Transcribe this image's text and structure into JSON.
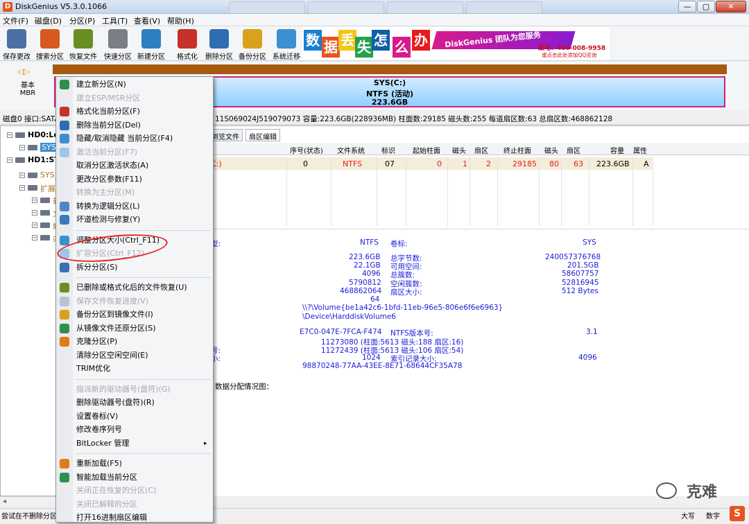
{
  "window": {
    "title": "DiskGenius V5.3.0.1066",
    "minimize_glyph": "—",
    "maximize_glyph": "▢",
    "close_glyph": "✕"
  },
  "menubar": [
    "文件(F)",
    "磁盘(D)",
    "分区(P)",
    "工具(T)",
    "查看(V)",
    "帮助(H)"
  ],
  "toolbar": [
    {
      "label": "保存更改",
      "icon": "save-icon",
      "color": "#4a6fa5"
    },
    {
      "label": "搜索分区",
      "icon": "search-icon",
      "color": "#d9581d"
    },
    {
      "label": "恢复文件",
      "icon": "recover-icon",
      "color": "#6b8e23"
    },
    {
      "label": "快速分区",
      "icon": "quick-partition-icon",
      "color": "#7a7f86"
    },
    {
      "label": "新建分区",
      "icon": "new-partition-icon",
      "color": "#2e7fbf"
    },
    {
      "label": "格式化",
      "icon": "format-icon",
      "color": "#c8302a"
    },
    {
      "label": "删除分区",
      "icon": "delete-icon",
      "color": "#2f6db3"
    },
    {
      "label": "备份分区",
      "icon": "backup-icon",
      "color": "#d8a21c"
    },
    {
      "label": "系统迁移",
      "icon": "migrate-icon",
      "color": "#3c8fd1"
    }
  ],
  "banner": {
    "chars": [
      "数",
      "据",
      "丢",
      "失",
      "怎",
      "么",
      "办"
    ],
    "slogan": "DiskGenius 团队为您服务",
    "phone": "致电：400-008-9958",
    "qq": "或点击此处添加QQ咨询"
  },
  "disk": {
    "type": "基本",
    "scheme": "MBR",
    "partition_name": "SYS(C:)",
    "partition_fs": "NTFS (活动)",
    "partition_size": "223.6GB",
    "info_prefix": "磁盘0 接口:SATA",
    "info_line": "11S069024J519079073  容量:223.6GB(228936MB)  柱面数:29185  磁头数:255  每道扇区数:63  总扇区数:468862128"
  },
  "tree": [
    {
      "text": "HD0:Le",
      "indent": 22,
      "bold": true
    },
    {
      "text": "SYS(",
      "indent": 40,
      "selected": true
    },
    {
      "text": "HD1:ST",
      "indent": 22,
      "bold": true
    },
    {
      "text": "SYS_",
      "indent": 40
    },
    {
      "text": "扩展",
      "indent": 40
    },
    {
      "text": "软",
      "indent": 58
    },
    {
      "text": "文",
      "indent": 58
    },
    {
      "text": "娱",
      "indent": 58
    },
    {
      "text": "办",
      "indent": 58
    }
  ],
  "tabs": [
    "浏览文件",
    "扇区编辑"
  ],
  "table": {
    "headers": [
      "序号(状态)",
      "文件系统",
      "标识",
      "起始柱面",
      "磁头",
      "扇区",
      "终止柱面",
      "磁头",
      "扇区",
      "容量",
      "属性"
    ],
    "row": {
      "name_tail": "C:)",
      "cells": [
        "0",
        "NTFS",
        "07",
        "0",
        "1",
        "2",
        "29185",
        "80",
        "63",
        "223.6GB",
        "A"
      ],
      "accent": "#e81a1a"
    }
  },
  "info": {
    "fs_label_tail": "型:",
    "fs": "NTFS",
    "vol_label": "卷标:",
    "vol": "SYS",
    "total_size": "223.6GB",
    "total_bytes_label": "总字节数:",
    "total_bytes": "240057376768",
    "used": "22.1GB",
    "free_label": "可用空间:",
    "free": "201.5GB",
    "cluster": "4096",
    "total_clusters_label": "总簇数:",
    "total_clusters": "58607757",
    "free_clusters_val": "5790812",
    "free_clusters_label": "空闲簇数:",
    "free_clusters": "52816945",
    "total_sectors": "468862064",
    "sector_size_label": "扇区大小:",
    "sector_size": "512 Bytes",
    "start_sector": "64",
    "volume_guid": "\\\\?\\Volume{be1a42c6-1bfd-11eb-96e5-806e6f6e6963}",
    "device_path": "\\Device\\HarddiskVolume6",
    "serial": "E7C0-047E-7FCA-F474",
    "ntfs_ver_label": "NTFS版本号:",
    "ntfs_ver": "3.1",
    "mft_label_tail": "号:",
    "mft": "11273080 (柱面:5613 磁头:188 扇区:16)",
    "mftmirr": "11272439 (柱面:5613 磁头:106 扇区:54)",
    "rec_label_tail": "小:",
    "rec_size": "1024",
    "index_label": "索引记录大小:",
    "index_size": "4096",
    "guid2": "98870248-77AA-43EE-8E71-68644CF35A78",
    "alloc_label": "数据分配情况图："
  },
  "context_menu": [
    {
      "label": "建立新分区(N)",
      "enabled": true,
      "icon": "#2f8f4e"
    },
    {
      "label": "建立ESP/MSR分区",
      "enabled": false
    },
    {
      "label": "格式化当前分区(F)",
      "enabled": true,
      "icon": "#c8302a"
    },
    {
      "label": "删除当前分区(Del)",
      "enabled": true,
      "icon": "#2f6db3"
    },
    {
      "label": "隐藏/取消隐藏 当前分区(F4)",
      "enabled": true,
      "icon": "#3c8fd1"
    },
    {
      "label": "激活当前分区(F7)",
      "enabled": false,
      "icon": "#9fc6e8"
    },
    {
      "label": "取消分区激活状态(A)",
      "enabled": true
    },
    {
      "label": "更改分区参数(F11)",
      "enabled": true
    },
    {
      "label": "转换为主分区(M)",
      "enabled": false
    },
    {
      "label": "转换为逻辑分区(L)",
      "enabled": true,
      "icon": "#4f86c6"
    },
    {
      "label": "坏道检测与修复(Y)",
      "enabled": true,
      "icon": "#3a7bbf"
    },
    {
      "sep": true
    },
    {
      "label": "调整分区大小(Ctrl_F11)",
      "enabled": true,
      "icon": "#3c8fd1"
    },
    {
      "label": "扩容分区(Ctrl_F12)",
      "enabled": false,
      "icon": "#9fc6e8"
    },
    {
      "label": "拆分分区(S)",
      "enabled": true,
      "icon": "#3c6fb0"
    },
    {
      "sep": true
    },
    {
      "label": "已删除或格式化后的文件恢复(U)",
      "enabled": true,
      "icon": "#6b8e23"
    },
    {
      "label": "保存文件恢复进度(V)",
      "enabled": false,
      "icon": "#b9c3d0"
    },
    {
      "label": "备份分区到镜像文件(I)",
      "enabled": true,
      "icon": "#d8a21c"
    },
    {
      "label": "从镜像文件还原分区(S)",
      "enabled": true,
      "icon": "#2f8f4e"
    },
    {
      "label": "克隆分区(P)",
      "enabled": true,
      "icon": "#e07b1a"
    },
    {
      "label": "清除分区空闲空间(E)",
      "enabled": true
    },
    {
      "label": "TRIM优化",
      "enabled": true
    },
    {
      "sep": true
    },
    {
      "label": "指派新的驱动器号(盘符)(G)",
      "enabled": false
    },
    {
      "label": "删除驱动器号(盘符)(R)",
      "enabled": true
    },
    {
      "label": "设置卷标(V)",
      "enabled": true
    },
    {
      "label": "修改卷序列号",
      "enabled": true
    },
    {
      "label": "BitLocker 管理",
      "enabled": true,
      "submenu": true
    },
    {
      "sep": true
    },
    {
      "label": "重新加载(F5)",
      "enabled": true,
      "icon": "#e07b1a"
    },
    {
      "label": "智能加载当前分区",
      "enabled": true,
      "icon": "#2f8f4e"
    },
    {
      "label": "关闭正在恢复的分区(C)",
      "enabled": false
    },
    {
      "label": "关闭已解释的分区",
      "enabled": false
    },
    {
      "label": "打开16进制扇区编辑",
      "enabled": true
    }
  ],
  "status": {
    "left": "尝试在不删除分区",
    "caps": "大写",
    "num": "数字"
  },
  "watermark": {
    "text": "克难"
  },
  "corner_badge": "S"
}
